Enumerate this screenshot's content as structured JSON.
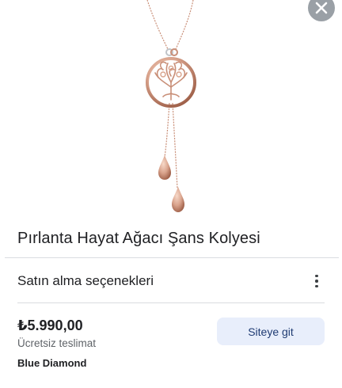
{
  "product": {
    "title": "Pırlanta Hayat Ağacı Şans Kolyesi",
    "image_icon": "necklace-image"
  },
  "purchase_options": {
    "section_title": "Satın alma seçenekleri",
    "more_icon": "more-vert-icon"
  },
  "offer": {
    "price": "₺5.990,00",
    "shipping": "Ücretsiz teslimat",
    "merchant": "Blue Diamond",
    "visit_button_label": "Siteye git"
  },
  "close_icon": "close-icon",
  "colors": {
    "rose_gold": "#d9a38c",
    "rose_gold_dark": "#b5765e",
    "close_bg": "#9aa0a6",
    "button_bg": "#e8eefb",
    "button_text": "#1f3b73",
    "divider": "#dadce0"
  }
}
